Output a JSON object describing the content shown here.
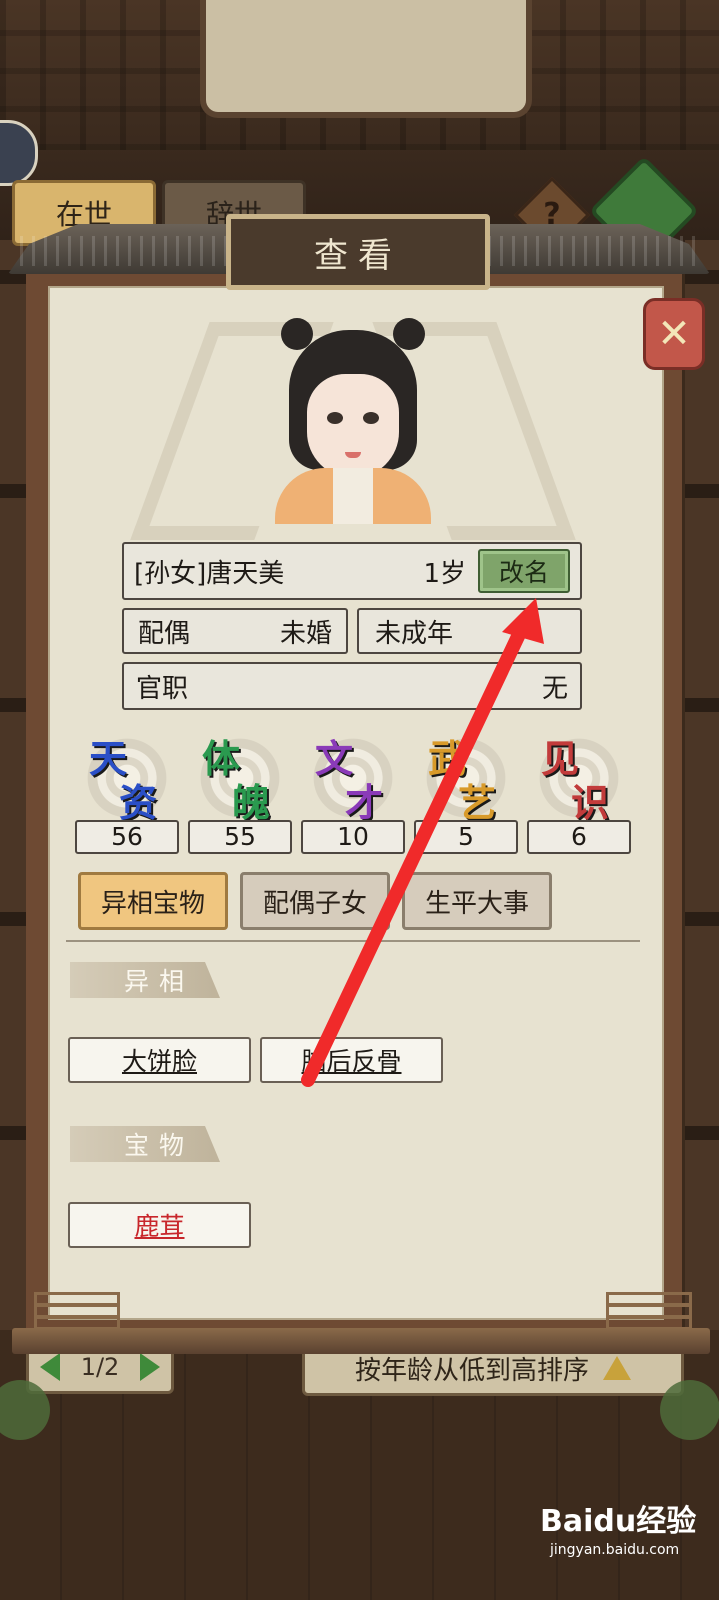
{
  "tabs": {
    "alive": "在世",
    "deceased": "辞世"
  },
  "help_label": "?",
  "dialog": {
    "title": "查看",
    "close_icon": "close-x-icon",
    "character": {
      "name": "[孙女]唐天美",
      "age": "1岁",
      "rename_label": "改名",
      "spouse_label": "配偶",
      "spouse_value": "未婚",
      "maturity": "未成年",
      "office_label": "官职",
      "office_value": "无"
    },
    "stats": [
      {
        "c1": "天",
        "c2": "资",
        "value": "56",
        "color": "#2a4fc7"
      },
      {
        "c1": "体",
        "c2": "魄",
        "value": "55",
        "color": "#2a9a4f"
      },
      {
        "c1": "文",
        "c2": "才",
        "value": "10",
        "color": "#8a3ab8"
      },
      {
        "c1": "武",
        "c2": "艺",
        "value": "5",
        "color": "#d89a2a"
      },
      {
        "c1": "见",
        "c2": "识",
        "value": "6",
        "color": "#c23b3b"
      }
    ],
    "sub_tabs": [
      "异相宝物",
      "配偶子女",
      "生平大事"
    ],
    "section_traits": "异相",
    "traits": [
      "大饼脸",
      "脑后反骨"
    ],
    "section_treasures": "宝物",
    "treasures": [
      "鹿茸"
    ],
    "treasure_color": "#c8262b"
  },
  "pager": {
    "page": "1/2"
  },
  "sort_label": "按年龄从低到高排序",
  "watermark": {
    "brand": "Baidu经验",
    "url": "jingyan.baidu.com"
  },
  "annotation_color": "#f02a2a"
}
